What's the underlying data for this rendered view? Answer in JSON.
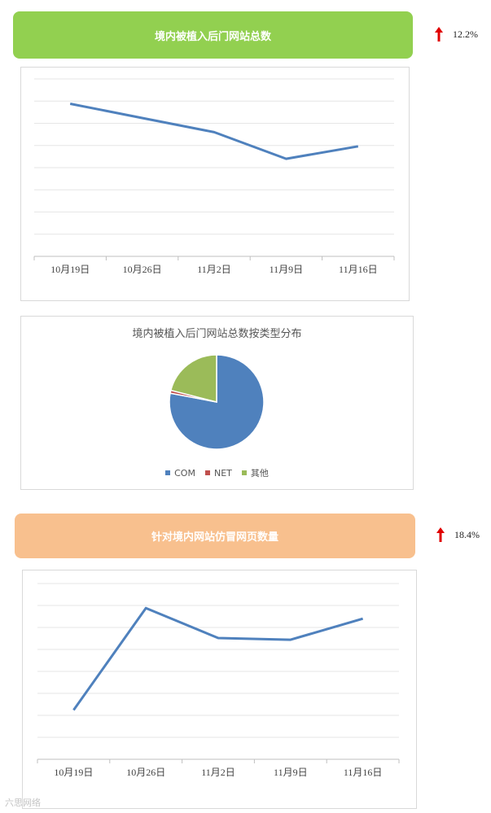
{
  "colors": {
    "banner1": "#92d050",
    "banner2": "#f8c08e",
    "line": "#4f81bd",
    "pie_com": "#4f81bd",
    "pie_net": "#c0504d",
    "pie_other": "#9bbb59",
    "arrow": "#e00000"
  },
  "section1": {
    "title": "境内被植入后门网站总数",
    "change": "12.2%",
    "change_icon": "arrow-up-icon"
  },
  "section2": {
    "title": "针对境内网站仿冒网页数量",
    "change": "18.4%",
    "change_icon": "arrow-up-icon"
  },
  "watermark": "六思网络",
  "chart_data": [
    {
      "type": "line",
      "categories": [
        "10月19日",
        "10月26日",
        "11月2日",
        "11月9日",
        "11月16日"
      ],
      "series": [
        {
          "values": [
            86,
            78,
            70,
            55,
            62
          ]
        }
      ],
      "ylim": [
        0,
        100
      ],
      "grid": true,
      "legend": "none"
    },
    {
      "type": "pie",
      "title": "境内被植入后门网站总数按类型分布",
      "categories": [
        "COM",
        "NET",
        "其他"
      ],
      "values": [
        78,
        1,
        21
      ],
      "legend": "bottom"
    },
    {
      "type": "line",
      "categories": [
        "10月19日",
        "10月26日",
        "11月2日",
        "11月9日",
        "11月16日"
      ],
      "series": [
        {
          "values": [
            28,
            86,
            69,
            68,
            80
          ]
        }
      ],
      "ylim": [
        0,
        100
      ],
      "grid": true,
      "legend": "none"
    }
  ]
}
